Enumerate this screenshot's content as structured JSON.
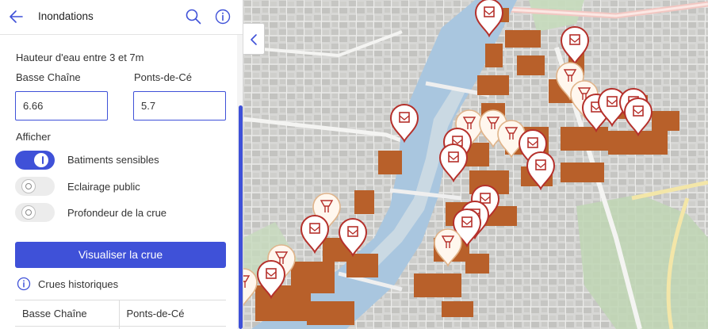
{
  "header": {
    "title": "Inondations",
    "icons": [
      "arrow-left-icon",
      "search-icon",
      "info-icon"
    ]
  },
  "form": {
    "height_label": "Hauteur d'eau entre 3 et 7m",
    "field1_label": "Basse Chaîne",
    "field1_value": "6.66",
    "field2_label": "Ponts-de-Cé",
    "field2_value": "5.7"
  },
  "display": {
    "section_label": "Afficher",
    "toggles": [
      {
        "label": "Batiments sensibles",
        "on": true
      },
      {
        "label": "Eclairage public",
        "on": false
      },
      {
        "label": "Profondeur de la crue",
        "on": false
      }
    ]
  },
  "action": {
    "visualize_label": "Visualiser la crue"
  },
  "history": {
    "title": "Crues historiques",
    "columns": [
      "Basse Chaîne",
      "Ponts-de-Cé"
    ]
  },
  "colors": {
    "accent": "#3f51d8",
    "river": "#a9c6df",
    "buildings": "#b8602a",
    "marker": "#b5302b"
  }
}
